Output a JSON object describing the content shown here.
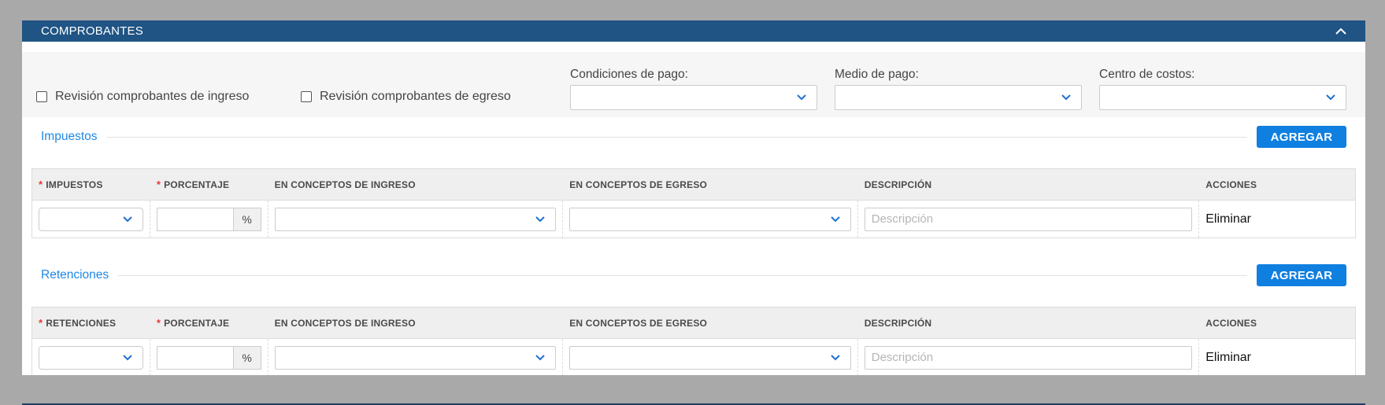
{
  "panel": {
    "title": "COMPROBANTES",
    "collapse_icon": "chevron-up-icon"
  },
  "filters": {
    "check_ingreso": "Revisión comprobantes de ingreso",
    "check_egreso": "Revisión comprobantes de egreso",
    "condiciones_label": "Condiciones de pago:",
    "medio_label": "Medio de pago:",
    "centro_label": "Centro de costos:"
  },
  "impuestos": {
    "title": "Impuestos",
    "add_label": "AGREGAR",
    "headers": {
      "col1": "IMPUESTOS",
      "col2": "PORCENTAJE",
      "col3": "EN CONCEPTOS DE INGRESO",
      "col4": "EN CONCEPTOS DE EGRESO",
      "col5": "DESCRIPCIÓN",
      "col6": "ACCIONES"
    },
    "row": {
      "pct_addon": "%",
      "desc_placeholder": "Descripción",
      "action": "Eliminar"
    }
  },
  "retenciones": {
    "title": "Retenciones",
    "add_label": "AGREGAR",
    "headers": {
      "col1": "RETENCIONES",
      "col2": "PORCENTAJE",
      "col3": "EN CONCEPTOS DE INGRESO",
      "col4": "EN CONCEPTOS DE EGRESO",
      "col5": "DESCRIPCIÓN",
      "col6": "ACCIONES"
    },
    "row": {
      "pct_addon": "%",
      "desc_placeholder": "Descripción",
      "action": "Eliminar"
    }
  },
  "required_mark": "*",
  "colors": {
    "header_bg": "#1f5484",
    "accent": "#1e88e5",
    "button": "#0f7fe0",
    "required": "#e53935"
  }
}
